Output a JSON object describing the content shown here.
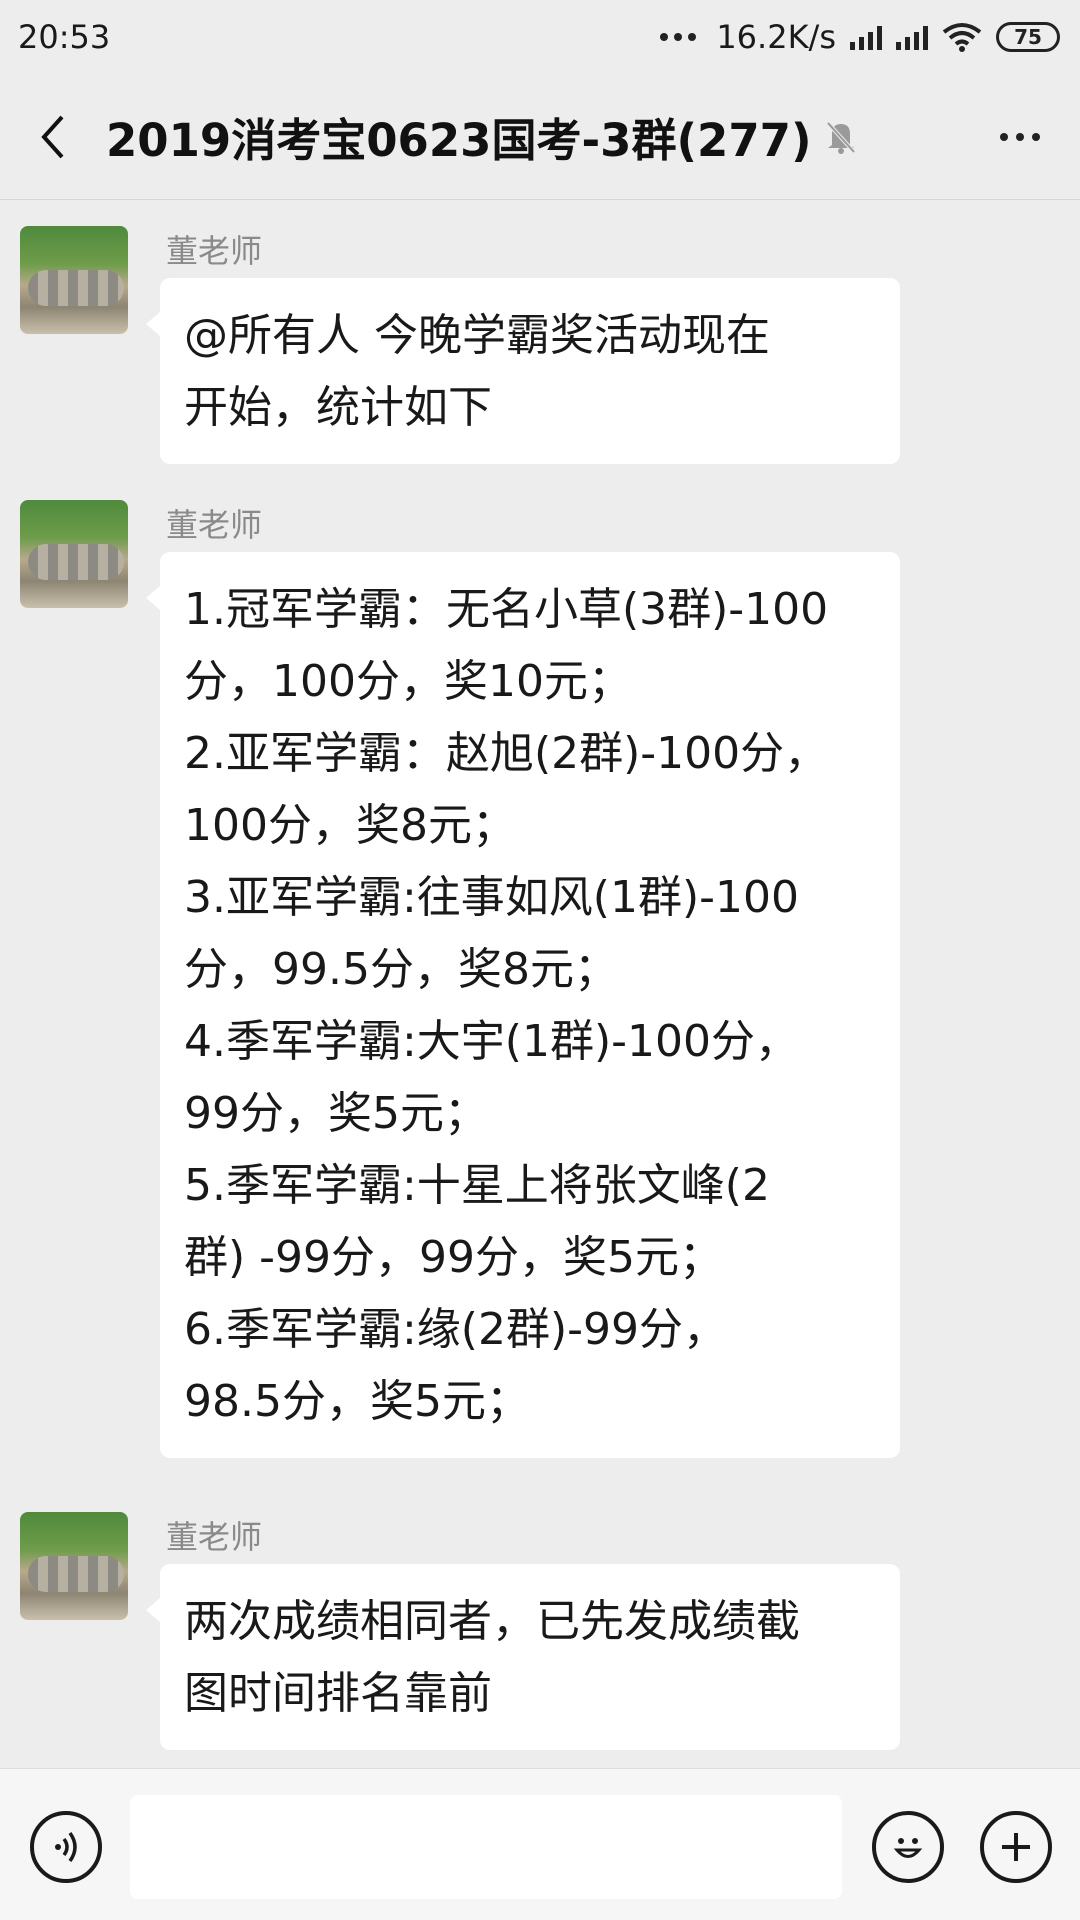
{
  "status_bar": {
    "time": "20:53",
    "network_speed": "16.2K/s",
    "battery": "75"
  },
  "header": {
    "title": "2019消考宝0623国考-3群(277)",
    "back_icon": "chevron-left-icon",
    "mute_icon": "bell-muted-icon",
    "more_icon": "more-dots-icon"
  },
  "messages": [
    {
      "sender": "董老师",
      "lines": [
        "@所有人   今晚学霸奖活动现在",
        "开始，统计如下"
      ]
    },
    {
      "sender": "董老师",
      "lines": [
        "1.冠军学霸：无名小草(3群)-100",
        "分，100分，奖10元；",
        "2.亚军学霸：赵旭(2群)-100分，",
        "100分，奖8元；",
        "3.亚军学霸:往事如风(1群)-100",
        "分，99.5分，奖8元；",
        "4.季军学霸:大宇(1群)-100分，",
        "99分，奖5元；",
        "5.季军学霸:十星上将张文峰(2",
        "群) -99分，99分，奖5元；",
        "6.季军学霸:缘(2群)-99分，",
        "98.5分，奖5元；"
      ]
    },
    {
      "sender": "董老师",
      "lines": [
        "两次成绩相同者，已先发成绩截",
        "图时间排名靠前"
      ]
    }
  ],
  "input_bar": {
    "voice_icon": "voice-icon",
    "emoji_icon": "emoji-icon",
    "plus_icon": "plus-icon"
  }
}
